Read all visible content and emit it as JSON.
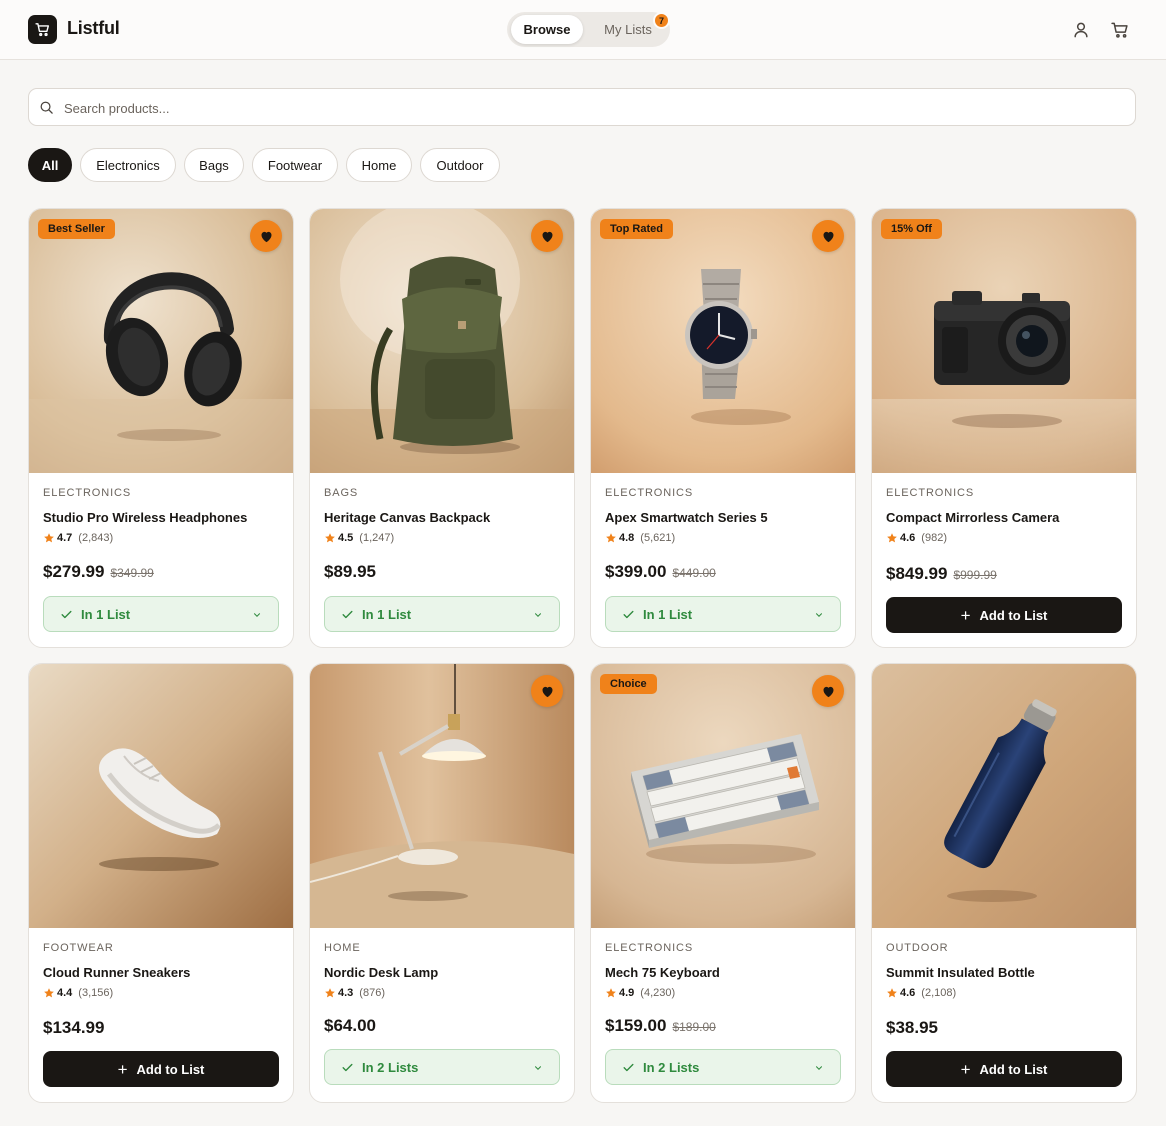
{
  "app": {
    "name": "Listful"
  },
  "nav": {
    "browse_label": "Browse",
    "lists_label": "My Lists",
    "lists_badge": "7",
    "account_icon": "user-icon",
    "cart_icon": "cart-icon"
  },
  "search": {
    "placeholder": "Search products..."
  },
  "filters": [
    "All",
    "Electronics",
    "Bags",
    "Footwear",
    "Home",
    "Outdoor"
  ],
  "filters_active": "All",
  "colors": {
    "accent": "#f0821a",
    "dark": "#1a1714",
    "success": "#2f8a3e",
    "success_bg": "#eaf5ea"
  },
  "products": [
    {
      "tag": "Best Seller",
      "favorited": true,
      "category": "ELECTRONICS",
      "name": "Studio Pro Wireless Headphones",
      "rating": "4.7",
      "reviews": "(2,843)",
      "price": "$279.99",
      "old_price": "$349.99",
      "list_status": "In 1 List",
      "action_label": "",
      "image": "headphones"
    },
    {
      "tag": "",
      "favorited": true,
      "category": "BAGS",
      "name": "Heritage Canvas Backpack",
      "rating": "4.5",
      "reviews": "(1,247)",
      "price": "$89.95",
      "old_price": "",
      "list_status": "In 1 List",
      "action_label": "",
      "image": "backpack"
    },
    {
      "tag": "Top Rated",
      "favorited": true,
      "category": "ELECTRONICS",
      "name": "Apex Smartwatch Series 5",
      "rating": "4.8",
      "reviews": "(5,621)",
      "price": "$399.00",
      "old_price": "$449.00",
      "list_status": "In 1 List",
      "action_label": "",
      "image": "watch"
    },
    {
      "tag": "15% Off",
      "favorited": false,
      "category": "ELECTRONICS",
      "name": "Compact Mirrorless Camera",
      "rating": "4.6",
      "reviews": "(982)",
      "price": "$849.99",
      "old_price": "$999.99",
      "list_status": "",
      "action_label": "Add to List",
      "image": "camera"
    },
    {
      "tag": "",
      "favorited": false,
      "category": "FOOTWEAR",
      "name": "Cloud Runner Sneakers",
      "rating": "4.4",
      "reviews": "(3,156)",
      "price": "$134.99",
      "old_price": "",
      "list_status": "",
      "action_label": "Add to List",
      "image": "sneaker"
    },
    {
      "tag": "",
      "favorited": true,
      "category": "HOME",
      "name": "Nordic Desk Lamp",
      "rating": "4.3",
      "reviews": "(876)",
      "price": "$64.00",
      "old_price": "",
      "list_status": "In 2 Lists",
      "action_label": "",
      "image": "lamp"
    },
    {
      "tag": "Choice",
      "favorited": true,
      "category": "ELECTRONICS",
      "name": "Mech 75 Keyboard",
      "rating": "4.9",
      "reviews": "(4,230)",
      "price": "$159.00",
      "old_price": "$189.00",
      "list_status": "In 2 Lists",
      "action_label": "",
      "image": "keyboard"
    },
    {
      "tag": "",
      "favorited": false,
      "category": "OUTDOOR",
      "name": "Summit Insulated Bottle",
      "rating": "4.6",
      "reviews": "(2,108)",
      "price": "$38.95",
      "old_price": "",
      "list_status": "",
      "action_label": "Add to List",
      "image": "bottle"
    }
  ]
}
